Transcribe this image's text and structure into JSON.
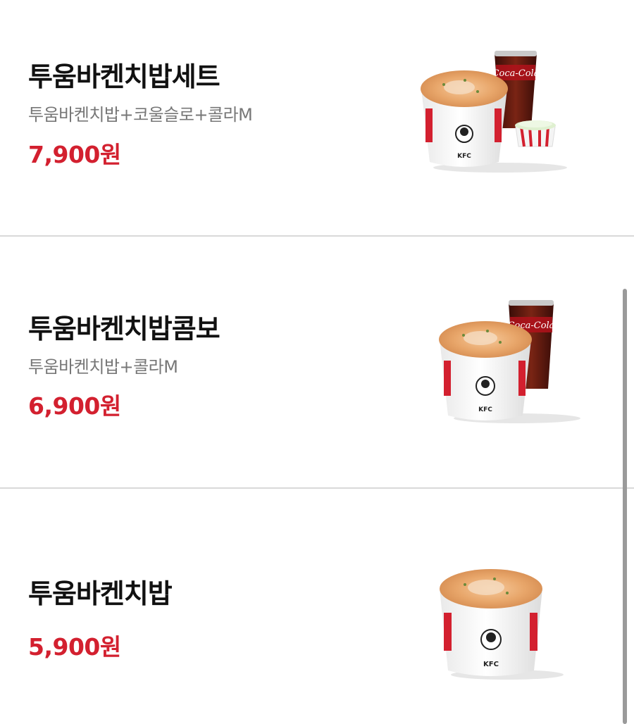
{
  "items": [
    {
      "name": "투움바켄치밥세트",
      "description": "투움바켄치밥+코울슬로+콜라M",
      "price": "7,900원",
      "image": "chicken-rice-bowl-with-cola-and-coleslaw",
      "cola_logo": "Coca-Cola",
      "bowl_logo": "KFC"
    },
    {
      "name": "투움바켄치밥콤보",
      "description": "투움바켄치밥+콜라M",
      "price": "6,900원",
      "image": "chicken-rice-bowl-with-cola",
      "cola_logo": "Coca-Cola",
      "bowl_logo": "KFC"
    },
    {
      "name": "투움바켄치밥",
      "price": "5,900원",
      "image": "chicken-rice-bowl",
      "bowl_logo": "KFC"
    }
  ],
  "colors": {
    "price": "#d3202f",
    "name": "#111111",
    "description": "#777777",
    "divider": "#d9d9d9",
    "bowl_stripe": "#d3202f",
    "cola": "#5a1a12"
  }
}
